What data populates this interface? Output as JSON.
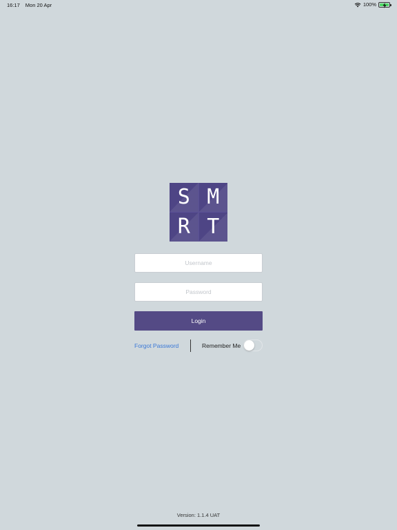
{
  "status_bar": {
    "time": "16:17",
    "date": "Mon 20 Apr",
    "battery": "100%",
    "wifi_icon": "wifi-icon",
    "battery_icon": "battery-charging-icon"
  },
  "logo": {
    "letters": [
      "S",
      "M",
      "R",
      "T"
    ],
    "color": "#4e4585"
  },
  "form": {
    "username": {
      "placeholder": "Username",
      "value": ""
    },
    "password": {
      "placeholder": "Password",
      "value": ""
    },
    "login_label": "Login",
    "login_color": "#544a85"
  },
  "options": {
    "forgot_password": "Forgot Password",
    "remember_me": "Remember Me",
    "remember_me_on": false,
    "link_color": "#3a78d6"
  },
  "footer": {
    "version": "Version: 1.1.4 UAT"
  },
  "colors": {
    "background": "#d0d8dc"
  }
}
